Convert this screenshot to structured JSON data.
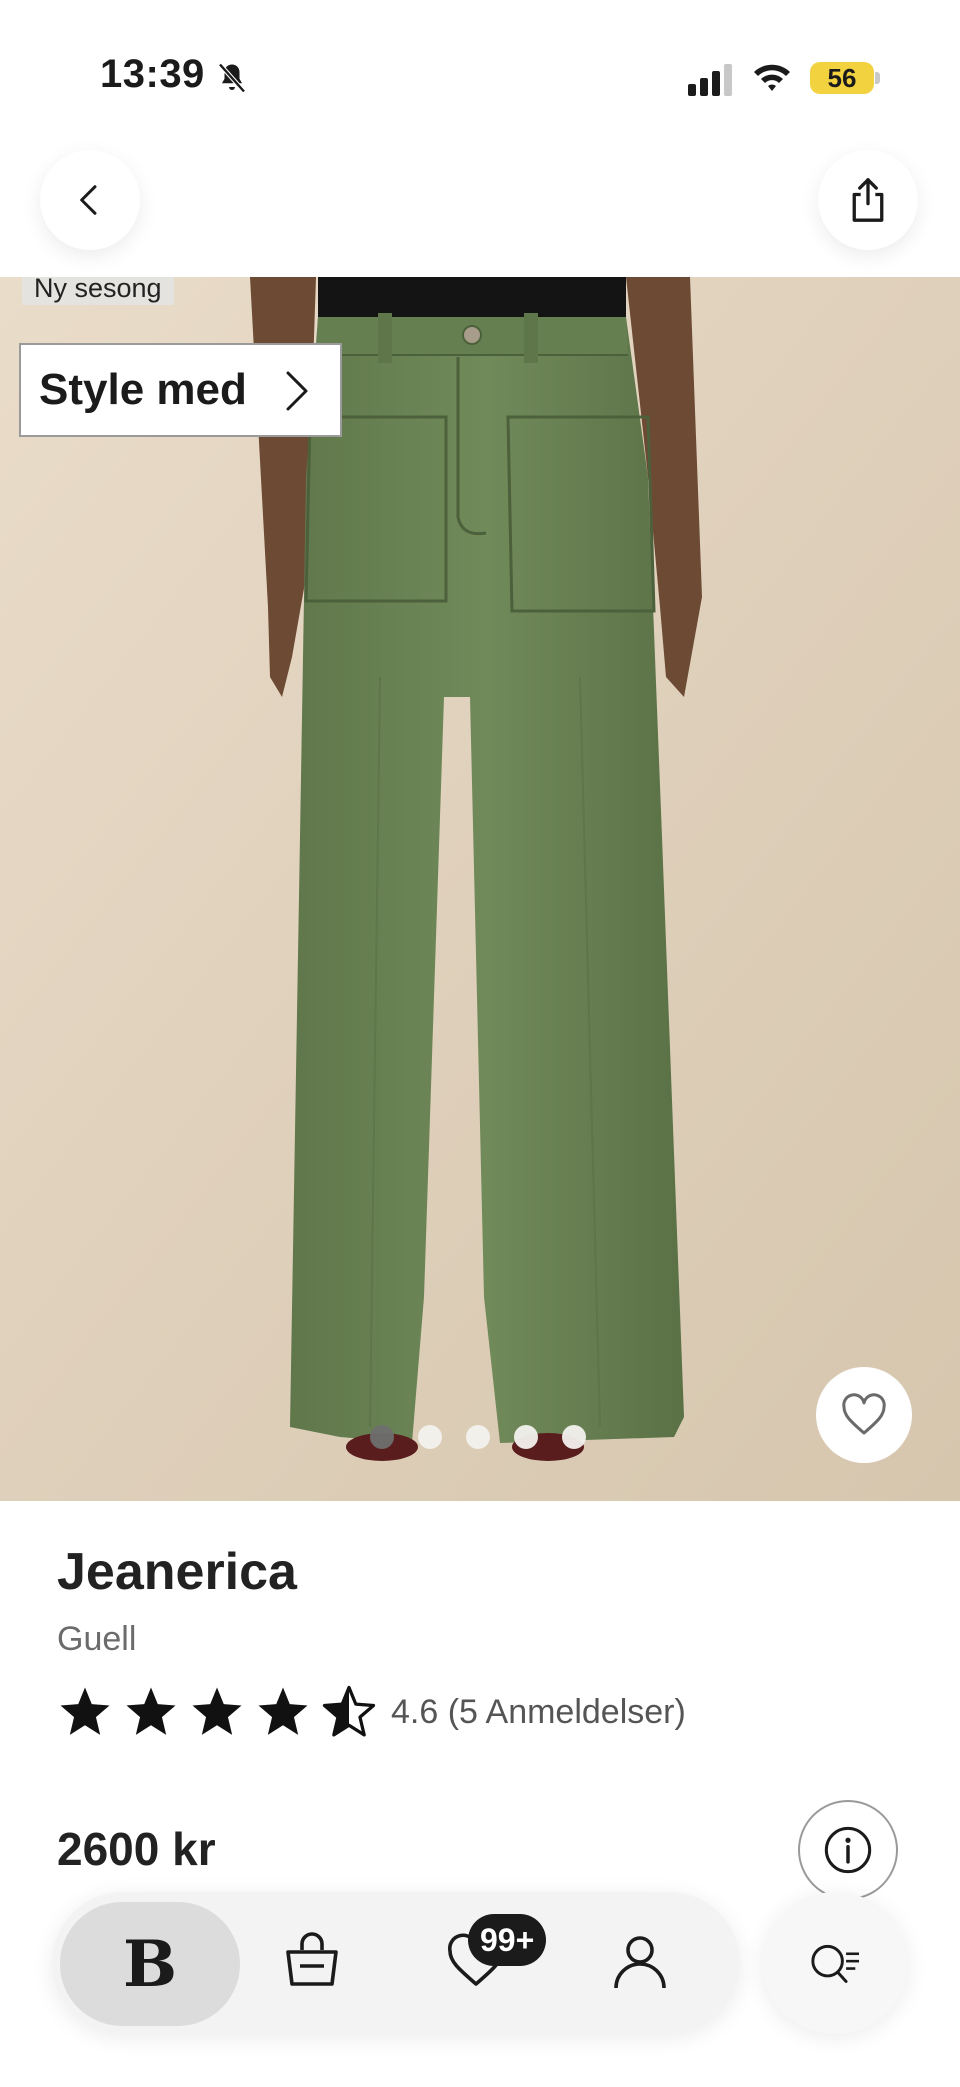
{
  "status_bar": {
    "time": "13:39",
    "battery": "56",
    "icons": [
      "bell-slash-icon",
      "cellular-signal-icon",
      "wifi-icon",
      "battery-icon"
    ]
  },
  "header": {
    "back_icon": "chevron-left-icon",
    "share_icon": "share-icon"
  },
  "gallery": {
    "ribbon_label": "Ny sesong",
    "style_button_label": "Style med",
    "dot_count": 5,
    "active_dot": 0,
    "favorite_icon": "heart-outline-icon"
  },
  "product": {
    "brand": "Jeanerica",
    "name": "Guell",
    "rating_value": 4.6,
    "rating_text": "4.6 (5 Anmeldelser)",
    "price": "2600 kr"
  },
  "bottom_nav": {
    "home_label": "B",
    "wishlist_badge": "99+",
    "items": [
      "home-logo",
      "shopping-bag-icon",
      "heart-icon",
      "account-icon",
      "search-assistant-icon"
    ]
  },
  "colors": {
    "pants_green": "#6d8656",
    "background_beige": "#e2d4c0",
    "battery_yellow": "#f3d23f"
  }
}
